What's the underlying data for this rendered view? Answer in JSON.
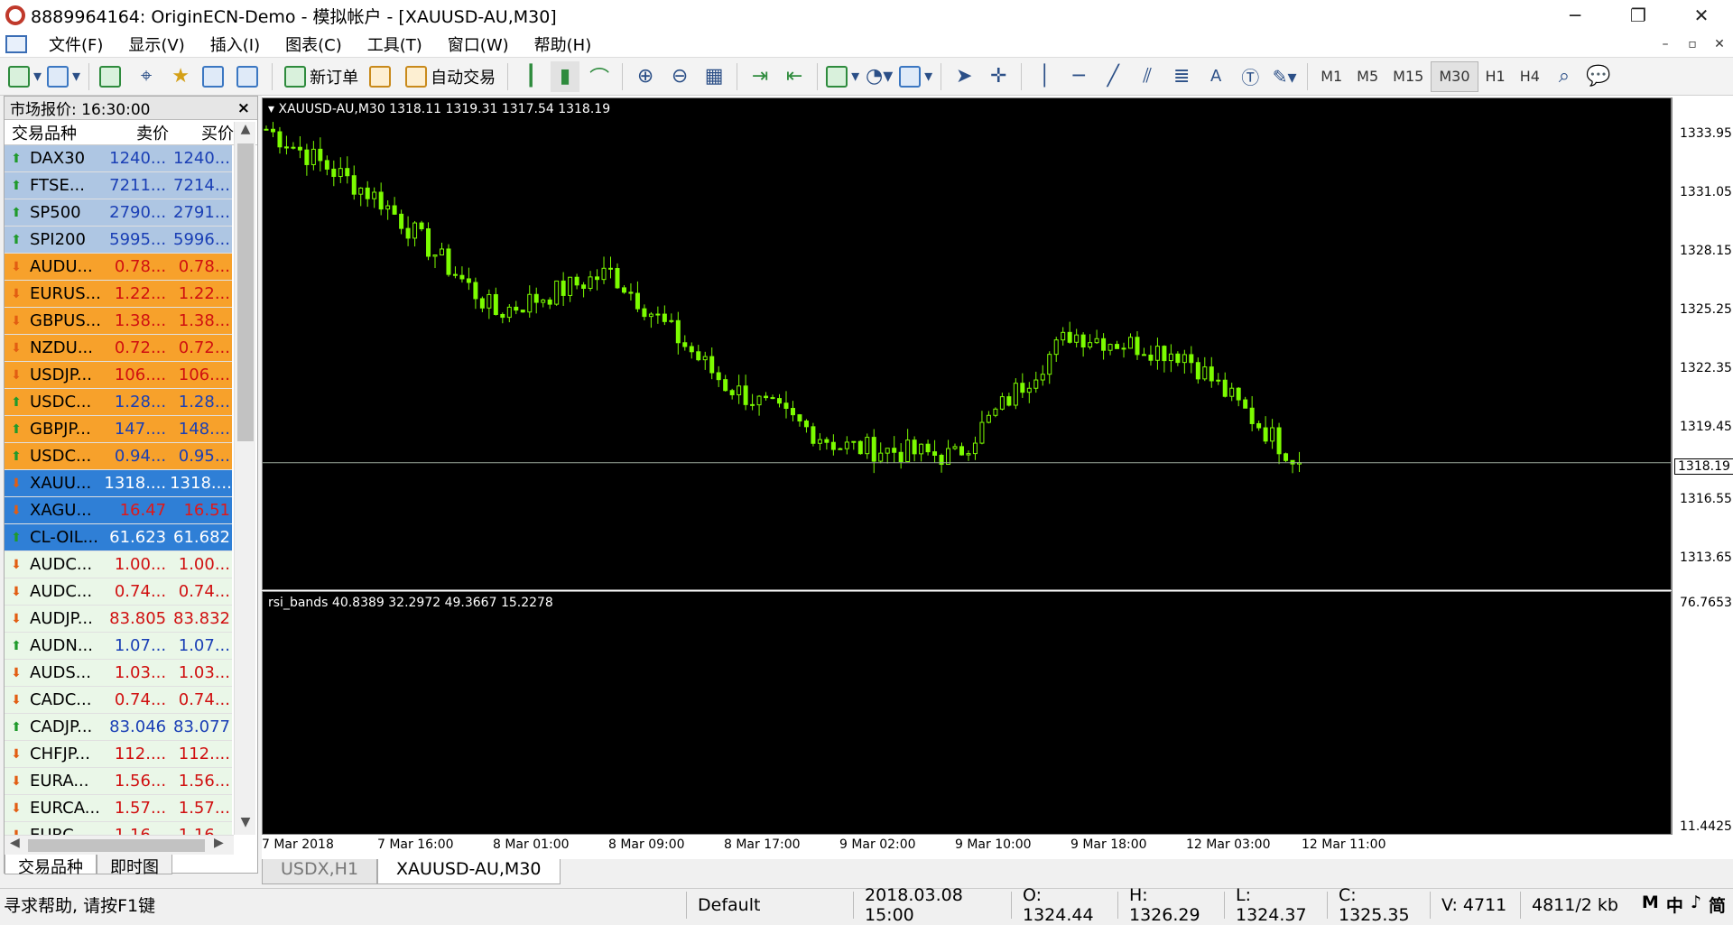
{
  "window": {
    "title": "8889964164: OriginECN-Demo - 模拟帐户 - [XAUUSD-AU,M30]"
  },
  "menu": [
    "文件(F)",
    "显示(V)",
    "插入(I)",
    "图表(C)",
    "工具(T)",
    "窗口(W)",
    "帮助(H)"
  ],
  "toolbar": {
    "new_order": "新订单",
    "auto_trade": "自动交易",
    "timeframes": [
      "M1",
      "M5",
      "M15",
      "M30",
      "H1",
      "H4"
    ],
    "active_timeframe": "M30",
    "text_tool": "A"
  },
  "market_watch": {
    "title": "市场报价: 16:30:00",
    "col_symbol": "交易品种",
    "col_bid": "卖价",
    "col_ask": "买价",
    "tabs": [
      "交易品种",
      "即时图"
    ],
    "rows": [
      {
        "symbol": "DAX30",
        "bid": "1240...",
        "ask": "1240...",
        "dir": "up",
        "bg": "#aec6e3",
        "color": "#1a3fb5"
      },
      {
        "symbol": "FTSE...",
        "bid": "7211...",
        "ask": "7214...",
        "dir": "up",
        "bg": "#aec6e3",
        "color": "#1a3fb5"
      },
      {
        "symbol": "SP500",
        "bid": "2790...",
        "ask": "2791...",
        "dir": "up",
        "bg": "#aec6e3",
        "color": "#1a3fb5"
      },
      {
        "symbol": "SPI200",
        "bid": "5995...",
        "ask": "5996...",
        "dir": "up",
        "bg": "#aec6e3",
        "color": "#1a3fb5"
      },
      {
        "symbol": "AUDU...",
        "bid": "0.78...",
        "ask": "0.78...",
        "dir": "down",
        "bg": "#f7a12b",
        "color": "#d01010"
      },
      {
        "symbol": "EURUS...",
        "bid": "1.22...",
        "ask": "1.22...",
        "dir": "down",
        "bg": "#f7a12b",
        "color": "#d01010"
      },
      {
        "symbol": "GBPUS...",
        "bid": "1.38...",
        "ask": "1.38...",
        "dir": "down",
        "bg": "#f7a12b",
        "color": "#d01010"
      },
      {
        "symbol": "NZDU...",
        "bid": "0.72...",
        "ask": "0.72...",
        "dir": "down",
        "bg": "#f7a12b",
        "color": "#d01010"
      },
      {
        "symbol": "USDJP...",
        "bid": "106....",
        "ask": "106....",
        "dir": "down",
        "bg": "#f7a12b",
        "color": "#d01010"
      },
      {
        "symbol": "USDC...",
        "bid": "1.28...",
        "ask": "1.28...",
        "dir": "up",
        "bg": "#f7a12b",
        "color": "#1a3fb5"
      },
      {
        "symbol": "GBPJP...",
        "bid": "147....",
        "ask": "148....",
        "dir": "up",
        "bg": "#f7a12b",
        "color": "#1a3fb5"
      },
      {
        "symbol": "USDC...",
        "bid": "0.94...",
        "ask": "0.95...",
        "dir": "up",
        "bg": "#f7a12b",
        "color": "#1a3fb5"
      },
      {
        "symbol": "XAUU...",
        "bid": "1318....",
        "ask": "1318....",
        "dir": "down",
        "bg": "#2f7fd6",
        "color": "#ffffff"
      },
      {
        "symbol": "XAGU...",
        "bid": "16.47",
        "ask": "16.51",
        "dir": "down",
        "bg": "#2f7fd6",
        "color": "#e01818"
      },
      {
        "symbol": "CL-OIL...",
        "bid": "61.623",
        "ask": "61.682",
        "dir": "up",
        "bg": "#2f7fd6",
        "color": "#ffffff"
      },
      {
        "symbol": "AUDC...",
        "bid": "1.00...",
        "ask": "1.00...",
        "dir": "down",
        "bg": "#eaf7e8",
        "color": "#d01010"
      },
      {
        "symbol": "AUDC...",
        "bid": "0.74...",
        "ask": "0.74...",
        "dir": "down",
        "bg": "#eaf7e8",
        "color": "#d01010"
      },
      {
        "symbol": "AUDJP...",
        "bid": "83.805",
        "ask": "83.832",
        "dir": "down",
        "bg": "#eaf7e8",
        "color": "#d01010"
      },
      {
        "symbol": "AUDN...",
        "bid": "1.07...",
        "ask": "1.07...",
        "dir": "up",
        "bg": "#eaf7e8",
        "color": "#1a3fb5"
      },
      {
        "symbol": "AUDS...",
        "bid": "1.03...",
        "ask": "1.03...",
        "dir": "down",
        "bg": "#eaf7e8",
        "color": "#d01010"
      },
      {
        "symbol": "CADC...",
        "bid": "0.74...",
        "ask": "0.74...",
        "dir": "down",
        "bg": "#eaf7e8",
        "color": "#d01010"
      },
      {
        "symbol": "CADJP...",
        "bid": "83.046",
        "ask": "83.077",
        "dir": "up",
        "bg": "#eaf7e8",
        "color": "#1a3fb5"
      },
      {
        "symbol": "CHFJP...",
        "bid": "112....",
        "ask": "112....",
        "dir": "down",
        "bg": "#eaf7e8",
        "color": "#d01010"
      },
      {
        "symbol": "EURA...",
        "bid": "1.56...",
        "ask": "1.56...",
        "dir": "down",
        "bg": "#eaf7e8",
        "color": "#d01010"
      },
      {
        "symbol": "EURCA...",
        "bid": "1.57...",
        "ask": "1.57...",
        "dir": "down",
        "bg": "#eaf7e8",
        "color": "#d01010"
      },
      {
        "symbol": "EURC...",
        "bid": "1.16...",
        "ask": "1.16...",
        "dir": "down",
        "bg": "#eaf7e8",
        "color": "#d01010"
      }
    ]
  },
  "chart": {
    "info": "XAUUSD-AU,M30  1318.11 1319.31 1317.54 1318.19",
    "indicator_label": "rsi_bands 40.8389 32.2972 49.3667 15.2278",
    "price_labels": [
      "1333.95",
      "1331.05",
      "1328.15",
      "1325.25",
      "1322.35",
      "1319.45",
      "1316.55",
      "1313.65"
    ],
    "current_price": "1318.19",
    "indicator_max": "76.7653",
    "indicator_min": "11.4425",
    "time_labels": [
      "7 Mar 2018",
      "7 Mar 16:00",
      "8 Mar 01:00",
      "8 Mar 09:00",
      "8 Mar 17:00",
      "9 Mar 02:00",
      "9 Mar 10:00",
      "9 Mar 18:00",
      "12 Mar 03:00",
      "12 Mar 11:00"
    ],
    "tabs": [
      "USDX,H1",
      "XAUUSD-AU,M30"
    ],
    "active_tab": "XAUUSD-AU,M30",
    "candle_color": "#7cfc00"
  },
  "chart_data": {
    "type": "line",
    "title": "XAUUSD-AU,M30",
    "x": [
      "7 Mar 2018",
      "7 Mar 16:00",
      "8 Mar 01:00",
      "8 Mar 09:00",
      "8 Mar 17:00",
      "9 Mar 02:00",
      "9 Mar 10:00",
      "9 Mar 18:00",
      "12 Mar 03:00",
      "12 Mar 11:00"
    ],
    "series": [
      {
        "values": [
          1334.5,
          1331.0,
          1325.5,
          1327.5,
          1322.0,
          1319.0,
          1318.5,
          1324.5,
          1323.5,
          1318.19
        ]
      }
    ],
    "ylim": [
      1312.0,
      1336.0
    ]
  },
  "status": {
    "help": "寻求帮助, 请按F1键",
    "profile": "Default",
    "time": "2018.03.08 15:00",
    "open": "O: 1324.44",
    "high": "H: 1326.29",
    "low": "L: 1324.37",
    "close": "C: 1325.35",
    "volume": "V: 4711",
    "traffic": "4811/2 kb",
    "ime": [
      "M",
      "中",
      "♪",
      "简"
    ]
  }
}
